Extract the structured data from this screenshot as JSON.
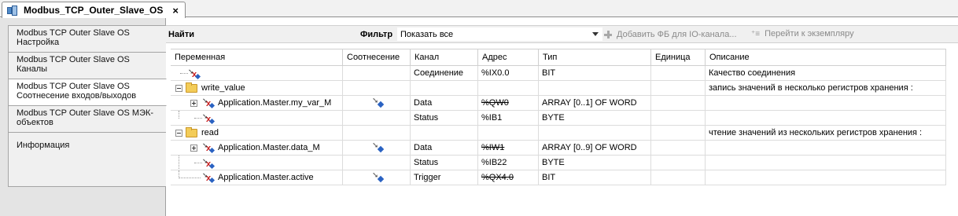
{
  "document_tab": {
    "title": "Modbus_TCP_Outer_Slave_OS",
    "close": "×"
  },
  "side_tabs": [
    {
      "line1": "Modbus TCP Outer Slave OS",
      "line2": "Настройка"
    },
    {
      "line1": "Modbus TCP Outer Slave OS",
      "line2": "Каналы"
    },
    {
      "line1": "Modbus TCP Outer Slave OS",
      "line2": "Соотнесение входов/выходов"
    },
    {
      "line1": "Modbus TCP Outer Slave OS МЭК-",
      "line2": "объектов"
    },
    {
      "line1": "Информация",
      "line2": ""
    }
  ],
  "active_side_tab": 2,
  "toolbar": {
    "find_label": "Найти",
    "filter_label": "Фильтр",
    "filter_value": "Показать все",
    "add_fb_label": "Добавить ФБ для IO-канала...",
    "goto_instance_label": "Перейти к экземпляру"
  },
  "table": {
    "columns": [
      "Переменная",
      "Соотнесение",
      "Канал",
      "Адрес",
      "Тип",
      "Единица",
      "Описание"
    ],
    "rows": [
      {
        "variable": "",
        "channel": "Соединение",
        "address": "%IX0.0",
        "type": "BIT",
        "unit": "",
        "description": "Качество соединения"
      },
      {
        "variable": "write_value",
        "channel": "",
        "address": "",
        "type": "",
        "unit": "",
        "description": "запись значений в несколько регистров хранения :"
      },
      {
        "variable": "Application.Master.my_var_M",
        "channel": "Data",
        "address": "%QW0",
        "type": "ARRAY [0..1] OF WORD",
        "unit": "",
        "description": ""
      },
      {
        "variable": "",
        "channel": "Status",
        "address": "%IB1",
        "type": "BYTE",
        "unit": "",
        "description": ""
      },
      {
        "variable": "read",
        "channel": "",
        "address": "",
        "type": "",
        "unit": "",
        "description": "чтение значений из нескольких регистров хранения :"
      },
      {
        "variable": "Application.Master.data_M",
        "channel": "Data",
        "address": "%IW1",
        "type": "ARRAY [0..9] OF WORD",
        "unit": "",
        "description": ""
      },
      {
        "variable": "",
        "channel": "Status",
        "address": "%IB22",
        "type": "BYTE",
        "unit": "",
        "description": ""
      },
      {
        "variable": "Application.Master.active",
        "channel": "Trigger",
        "address": "%QX4.0",
        "type": "BIT",
        "unit": "",
        "description": ""
      }
    ]
  },
  "colors": {
    "accent_blue": "#2a62c2",
    "folder_yellow": "#f3cc58",
    "io_red": "#c81e1e"
  }
}
